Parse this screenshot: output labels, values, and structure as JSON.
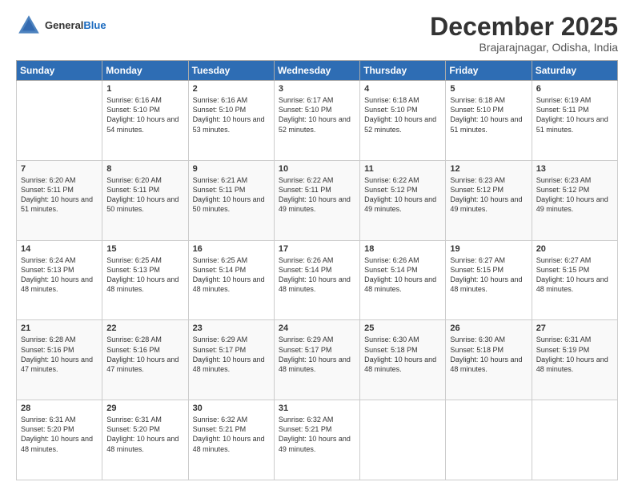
{
  "header": {
    "logo_general": "General",
    "logo_blue": "Blue",
    "month_title": "December 2025",
    "location": "Brajarajnagar, Odisha, India"
  },
  "days_of_week": [
    "Sunday",
    "Monday",
    "Tuesday",
    "Wednesday",
    "Thursday",
    "Friday",
    "Saturday"
  ],
  "weeks": [
    [
      {
        "day": "",
        "sunrise": "",
        "sunset": "",
        "daylight": ""
      },
      {
        "day": "1",
        "sunrise": "Sunrise: 6:16 AM",
        "sunset": "Sunset: 5:10 PM",
        "daylight": "Daylight: 10 hours and 54 minutes."
      },
      {
        "day": "2",
        "sunrise": "Sunrise: 6:16 AM",
        "sunset": "Sunset: 5:10 PM",
        "daylight": "Daylight: 10 hours and 53 minutes."
      },
      {
        "day": "3",
        "sunrise": "Sunrise: 6:17 AM",
        "sunset": "Sunset: 5:10 PM",
        "daylight": "Daylight: 10 hours and 52 minutes."
      },
      {
        "day": "4",
        "sunrise": "Sunrise: 6:18 AM",
        "sunset": "Sunset: 5:10 PM",
        "daylight": "Daylight: 10 hours and 52 minutes."
      },
      {
        "day": "5",
        "sunrise": "Sunrise: 6:18 AM",
        "sunset": "Sunset: 5:10 PM",
        "daylight": "Daylight: 10 hours and 51 minutes."
      },
      {
        "day": "6",
        "sunrise": "Sunrise: 6:19 AM",
        "sunset": "Sunset: 5:11 PM",
        "daylight": "Daylight: 10 hours and 51 minutes."
      }
    ],
    [
      {
        "day": "7",
        "sunrise": "Sunrise: 6:20 AM",
        "sunset": "Sunset: 5:11 PM",
        "daylight": "Daylight: 10 hours and 51 minutes."
      },
      {
        "day": "8",
        "sunrise": "Sunrise: 6:20 AM",
        "sunset": "Sunset: 5:11 PM",
        "daylight": "Daylight: 10 hours and 50 minutes."
      },
      {
        "day": "9",
        "sunrise": "Sunrise: 6:21 AM",
        "sunset": "Sunset: 5:11 PM",
        "daylight": "Daylight: 10 hours and 50 minutes."
      },
      {
        "day": "10",
        "sunrise": "Sunrise: 6:22 AM",
        "sunset": "Sunset: 5:11 PM",
        "daylight": "Daylight: 10 hours and 49 minutes."
      },
      {
        "day": "11",
        "sunrise": "Sunrise: 6:22 AM",
        "sunset": "Sunset: 5:12 PM",
        "daylight": "Daylight: 10 hours and 49 minutes."
      },
      {
        "day": "12",
        "sunrise": "Sunrise: 6:23 AM",
        "sunset": "Sunset: 5:12 PM",
        "daylight": "Daylight: 10 hours and 49 minutes."
      },
      {
        "day": "13",
        "sunrise": "Sunrise: 6:23 AM",
        "sunset": "Sunset: 5:12 PM",
        "daylight": "Daylight: 10 hours and 49 minutes."
      }
    ],
    [
      {
        "day": "14",
        "sunrise": "Sunrise: 6:24 AM",
        "sunset": "Sunset: 5:13 PM",
        "daylight": "Daylight: 10 hours and 48 minutes."
      },
      {
        "day": "15",
        "sunrise": "Sunrise: 6:25 AM",
        "sunset": "Sunset: 5:13 PM",
        "daylight": "Daylight: 10 hours and 48 minutes."
      },
      {
        "day": "16",
        "sunrise": "Sunrise: 6:25 AM",
        "sunset": "Sunset: 5:14 PM",
        "daylight": "Daylight: 10 hours and 48 minutes."
      },
      {
        "day": "17",
        "sunrise": "Sunrise: 6:26 AM",
        "sunset": "Sunset: 5:14 PM",
        "daylight": "Daylight: 10 hours and 48 minutes."
      },
      {
        "day": "18",
        "sunrise": "Sunrise: 6:26 AM",
        "sunset": "Sunset: 5:14 PM",
        "daylight": "Daylight: 10 hours and 48 minutes."
      },
      {
        "day": "19",
        "sunrise": "Sunrise: 6:27 AM",
        "sunset": "Sunset: 5:15 PM",
        "daylight": "Daylight: 10 hours and 48 minutes."
      },
      {
        "day": "20",
        "sunrise": "Sunrise: 6:27 AM",
        "sunset": "Sunset: 5:15 PM",
        "daylight": "Daylight: 10 hours and 48 minutes."
      }
    ],
    [
      {
        "day": "21",
        "sunrise": "Sunrise: 6:28 AM",
        "sunset": "Sunset: 5:16 PM",
        "daylight": "Daylight: 10 hours and 47 minutes."
      },
      {
        "day": "22",
        "sunrise": "Sunrise: 6:28 AM",
        "sunset": "Sunset: 5:16 PM",
        "daylight": "Daylight: 10 hours and 47 minutes."
      },
      {
        "day": "23",
        "sunrise": "Sunrise: 6:29 AM",
        "sunset": "Sunset: 5:17 PM",
        "daylight": "Daylight: 10 hours and 48 minutes."
      },
      {
        "day": "24",
        "sunrise": "Sunrise: 6:29 AM",
        "sunset": "Sunset: 5:17 PM",
        "daylight": "Daylight: 10 hours and 48 minutes."
      },
      {
        "day": "25",
        "sunrise": "Sunrise: 6:30 AM",
        "sunset": "Sunset: 5:18 PM",
        "daylight": "Daylight: 10 hours and 48 minutes."
      },
      {
        "day": "26",
        "sunrise": "Sunrise: 6:30 AM",
        "sunset": "Sunset: 5:18 PM",
        "daylight": "Daylight: 10 hours and 48 minutes."
      },
      {
        "day": "27",
        "sunrise": "Sunrise: 6:31 AM",
        "sunset": "Sunset: 5:19 PM",
        "daylight": "Daylight: 10 hours and 48 minutes."
      }
    ],
    [
      {
        "day": "28",
        "sunrise": "Sunrise: 6:31 AM",
        "sunset": "Sunset: 5:20 PM",
        "daylight": "Daylight: 10 hours and 48 minutes."
      },
      {
        "day": "29",
        "sunrise": "Sunrise: 6:31 AM",
        "sunset": "Sunset: 5:20 PM",
        "daylight": "Daylight: 10 hours and 48 minutes."
      },
      {
        "day": "30",
        "sunrise": "Sunrise: 6:32 AM",
        "sunset": "Sunset: 5:21 PM",
        "daylight": "Daylight: 10 hours and 48 minutes."
      },
      {
        "day": "31",
        "sunrise": "Sunrise: 6:32 AM",
        "sunset": "Sunset: 5:21 PM",
        "daylight": "Daylight: 10 hours and 49 minutes."
      },
      {
        "day": "",
        "sunrise": "",
        "sunset": "",
        "daylight": ""
      },
      {
        "day": "",
        "sunrise": "",
        "sunset": "",
        "daylight": ""
      },
      {
        "day": "",
        "sunrise": "",
        "sunset": "",
        "daylight": ""
      }
    ]
  ]
}
